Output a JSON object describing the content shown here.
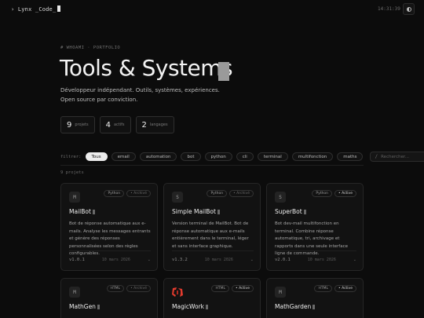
{
  "topbar": {
    "logo": "› Lynx _Code_",
    "clock": "14:31:39"
  },
  "hero": {
    "breadcrumb": "# WHOAMI · PORTFOLIO",
    "title": "Tools & Systems",
    "description_line1": "Développeur indépendant. Outils, systèmes, expériences.",
    "description_line2": "Open source par conviction."
  },
  "stats": [
    {
      "value": "9",
      "label": "projets"
    },
    {
      "value": "4",
      "label": "actifs"
    },
    {
      "value": "2",
      "label": "langages"
    }
  ],
  "filters": {
    "label": "filtrer:",
    "chips": [
      "Tous",
      "email",
      "automation",
      "bot",
      "python",
      "cli",
      "terminal",
      "multifonction",
      "maths"
    ],
    "active": "Tous",
    "search_placeholder": "Rechercher..."
  },
  "project_count": "9 projets",
  "cards": [
    {
      "initial": "M",
      "badges": [
        "Python",
        "• Archivé"
      ],
      "name": "MailBot",
      "description": "Bot de réponse automatique aux e-mails. Analyse les messages entrants et génère des réponses personnalisées selon des règles configurables.",
      "version": "v1.0.1",
      "date": "10 mars 2026"
    },
    {
      "initial": "S",
      "badges": [
        "Python",
        "• Archivé"
      ],
      "name": "Simple MailBot",
      "description": "Version terminal de MailBot. Bot de réponse automatique aux e-mails entièrement dans le terminal, léger et sans interface graphique.",
      "version": "v1.3.2",
      "date": "10 mars 2026"
    },
    {
      "initial": "S",
      "badges": [
        "Python",
        "• Active"
      ],
      "name": "SuperBot",
      "description": "Bot dev-mail multifonction en terminal. Combine réponse automatique, tri, archivage et rapports dans une seule interface ligne de commande.",
      "version": "v2.0.1",
      "date": "10 mars 2026"
    },
    {
      "initial": "M",
      "badges": [
        "HTML",
        "• Archivé"
      ],
      "name": "MathGen"
    },
    {
      "initial": "",
      "badges": [
        "HTML",
        "• Active"
      ],
      "name": "MagicWork"
    },
    {
      "initial": "M",
      "badges": [
        "HTML",
        "• Active"
      ],
      "name": "MathGarden"
    }
  ],
  "chevron": "⌄",
  "colors": {
    "accent": "#e23b2e",
    "background": "#0c0c0c"
  }
}
